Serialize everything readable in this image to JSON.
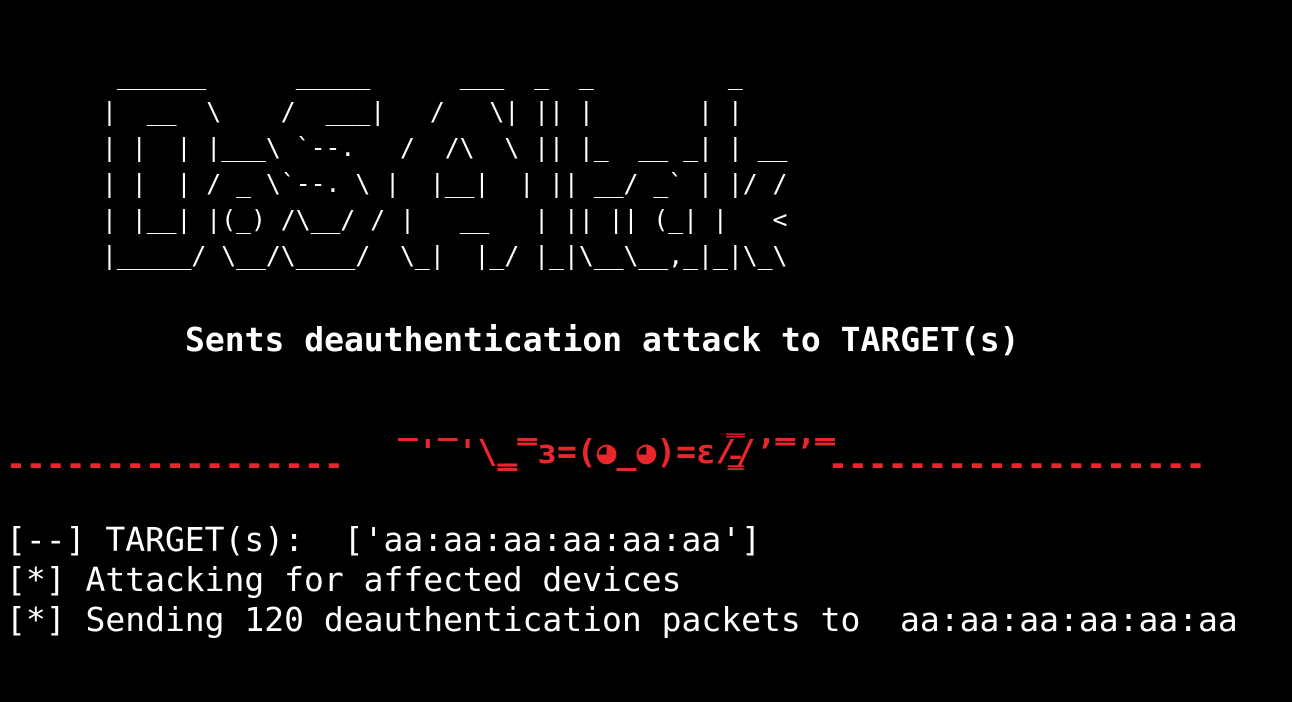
{
  "terminal": {
    "background": "#000000",
    "foreground": "#ffffff",
    "accent": "#e8262b"
  },
  "banner": {
    "ascii_art": " ______      _____      ___  _  _         _    \n|  __  \\    /  ___|   /   \\| || |       | |   \n| |  | |___\\ `--.   /  /\\  \\ || |_  __ _| | __\n| |  | / _ \\`--. \\ |  |__|  | || __/ _` | |/ /\n| |__| |(_) /\\__/ / |   __   | || || (_| |   < \n|_____/ \\__/\\____/  \\_|  |_/ |_|\\__\\__,_|_|\\_\\"
  },
  "subtitle": "Sents deauthentication attack to TARGET(s)",
  "divider": {
    "left_dashes": "-----------------",
    "kaomoji": "‾'‾'\\̳̿з=(◕_◕)=ε/̵͇̿̿/’̿’̿",
    "right_dashes": "-------------------"
  },
  "log": {
    "lines": [
      "[--] TARGET(s):  ['aa:aa:aa:aa:aa:aa']",
      "[*] Attacking for affected devices",
      "[*] Sending 120 deauthentication packets to  aa:aa:aa:aa:aa:aa"
    ]
  }
}
